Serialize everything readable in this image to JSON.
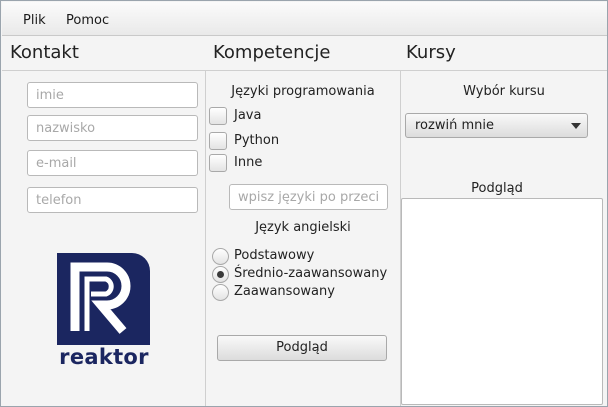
{
  "menu": {
    "file": "Plik",
    "help": "Pomoc"
  },
  "columns": {
    "contact": "Kontakt",
    "skills": "Kompetencje",
    "courses": "Kursy"
  },
  "contact": {
    "first_name_placeholder": "imie",
    "last_name_placeholder": "nazwisko",
    "email_placeholder": "e-mail",
    "phone_placeholder": "telefon"
  },
  "logo": {
    "text": "reaktor"
  },
  "skills": {
    "languages_label": "Języki programowania",
    "languages": [
      "Java",
      "Python",
      "Inne"
    ],
    "other_languages_placeholder": "wpisz języki po przecinku",
    "english_label": "Język angielski",
    "english_levels": [
      "Podstawowy",
      "Średnio-zaawansowany",
      "Zaawansowany"
    ],
    "english_selected": "Średnio-zaawansowany",
    "preview_button": "Podgląd"
  },
  "courses": {
    "select_label": "Wybór kursu",
    "select_value": "rozwiń mnie",
    "preview_label": "Podgląd",
    "preview_text": ""
  },
  "colors": {
    "brand": "#1b2660"
  }
}
